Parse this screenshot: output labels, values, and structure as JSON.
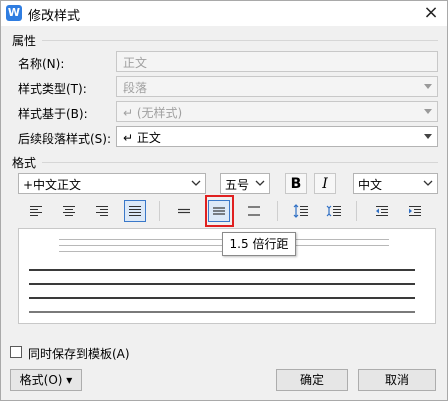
{
  "window": {
    "title": "修改样式",
    "logo_letter": "W",
    "close_symbol": "×"
  },
  "properties": {
    "section_label": "属性",
    "name": {
      "label": "名称(N):",
      "value": "正文"
    },
    "style_type": {
      "label": "样式类型(T):",
      "value": "段落"
    },
    "based_on": {
      "label": "样式基于(B):",
      "value": "↵ (无样式)"
    },
    "following": {
      "label": "后续段落样式(S):",
      "value": "↵ 正文"
    }
  },
  "format": {
    "section_label": "格式",
    "font": "+中文正文",
    "size": "五号",
    "bold_label": "B",
    "italic_label": "I",
    "script": "中文"
  },
  "tooltip": "1.5 倍行距",
  "preview": {
    "accent_color": "#000000"
  },
  "footer": {
    "save_to_template": "同时保存到模板(A)",
    "format_button": "格式(O) ▾",
    "ok": "确定",
    "cancel": "取消"
  },
  "colors": {
    "selected_border": "#3a78c9",
    "highlight_box": "#e02020",
    "logo": "#2f7de1"
  }
}
